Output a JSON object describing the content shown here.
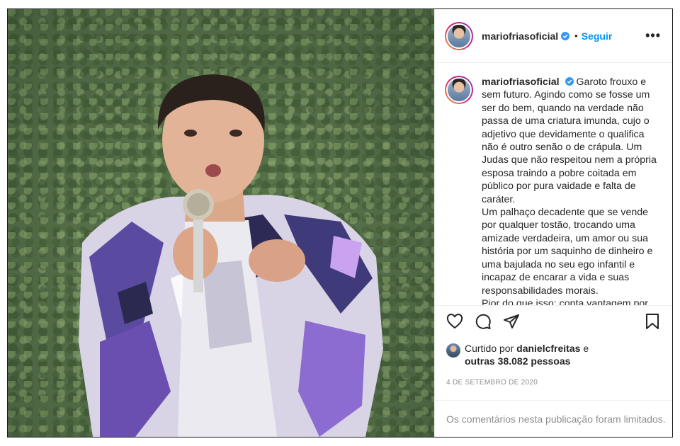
{
  "post": {
    "username": "mariofriasoficial",
    "follow_label": "Seguir",
    "separator": "•",
    "more_label": "•••",
    "caption": {
      "username": "mariofriasoficial",
      "text": "Garoto frouxo e sem futuro. Agindo como se fosse um ser do bem, quando na verdade não passa de uma criatura imunda, cujo o adjetivo que devidamente o qualifica não é outro senão o de crápula. Um Judas que não respeitou nem a própria esposa traindo a pobre coitada em público por pura vaidade e falta de caráter.\nUm palhaço decadente que se vende por qualquer tostão, trocando uma amizade verdadeira, um amor ou sua história por um saquinho de dinheiro e uma bajulada no seu ego infantil e incapaz de encarar a vida e suas responsabilidades morais.\nPior do que isso: conta vantagem por se considerar melhor que as outras"
    },
    "likes": {
      "prefix": "Curtido por",
      "liked_by": "danielcfreitas",
      "connector": "e",
      "others": "outras 38.082 pessoas"
    },
    "date": "4 DE SETEMBRO DE 2020",
    "comments_limited": "Os comentários nesta publicação foram limitados."
  },
  "icons": {
    "verified": "verified-badge-icon",
    "like": "heart-icon",
    "comment": "comment-icon",
    "share": "paper-plane-icon",
    "save": "bookmark-icon",
    "more": "more-dots-icon"
  },
  "colors": {
    "accent": "#0095f6",
    "muted": "#8e8e8e",
    "text": "#262626",
    "border": "#efefef"
  }
}
